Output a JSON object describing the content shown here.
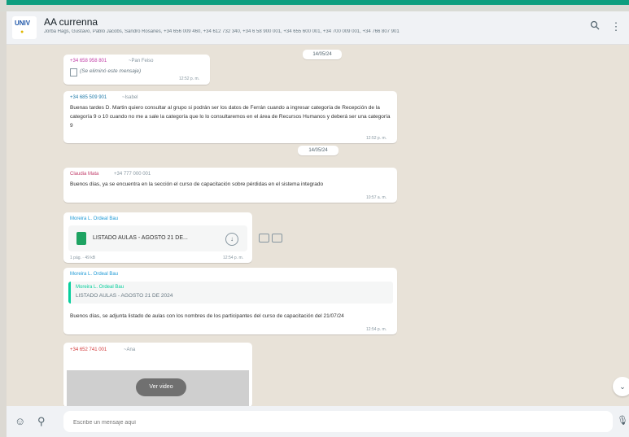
{
  "chat": {
    "title": "AA currenna",
    "members": "Jorba Hags, Gustavo, Pablo Jacobs, Sandro Rosanes, +34 656 009 460, +34 612 732 340, +34 6 58 900 001, +34 655 600 001, +34 700 009 001, +34 766 807 901"
  },
  "messages": {
    "m1": {
      "sender": "+34 658 958 801",
      "name": "~Pan Feiso",
      "doc": "(Se eliminó este mensaje)",
      "time": "12:52 p. m."
    },
    "m2": {
      "sender": "+34 685 509 901",
      "name": "~Isabel",
      "text": "Buenas tardes D. Martin quiero consultar al grupo si podrán ser los datos de Ferrán cuando a ingresar categoría de Recepción de la categoría 9 o 10 cuando no me a sale la categoría que lo lo consultaremos en el área de Recursos Humanos y deberá ser una categoría 9",
      "time": "12:52 p. m."
    },
    "date2": "14/05/24",
    "date1": "14/05/24",
    "m3": {
      "sender": "Claudia Mata",
      "meta": "+34 777 000 001",
      "text": "Buenos días, ya se encuentra en la sección el curso de capacitación sobre pérdidas en el sistema integrado",
      "time": "10:57 a. m."
    },
    "m4": {
      "sender": "Moreira L. Ordeal Bau",
      "file": "LISTADO AULAS - AGOSTO 21 DE...",
      "meta": "1 pág. · 49 kB",
      "time": "12:54 p. m."
    },
    "m5": {
      "sender": "Moreira L. Ordeal Bau",
      "quote_sender": "Moreira L. Ordeal Bau",
      "quote_text": "LISTADO AULAS - AGOSTO 21 DE 2024",
      "text": "Buenos días, se adjunta listado de aulas con los nombres de los participantes del curso de capacitación del 21/07/24",
      "time": "12:54 p. m."
    },
    "m6": {
      "sender": "+34 652 741 001",
      "name": "~Ana",
      "video": "Ver video"
    }
  },
  "footer": {
    "placeholder": "Escribe un mensaje aquí"
  }
}
